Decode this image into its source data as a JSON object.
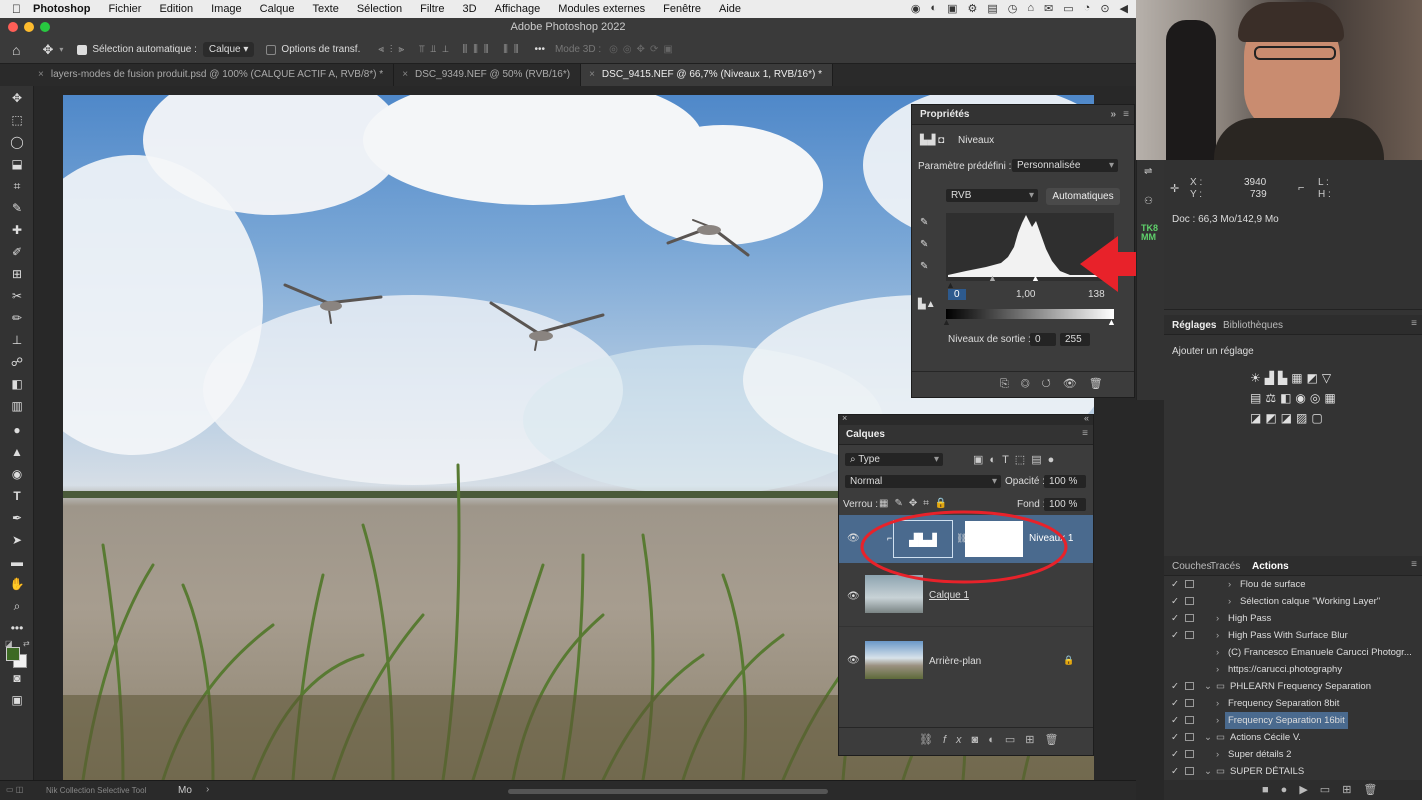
{
  "menubar": {
    "app_name": "Photoshop",
    "items": [
      "Fichier",
      "Edition",
      "Image",
      "Calque",
      "Texte",
      "Sélection",
      "Filtre",
      "3D",
      "Affichage",
      "Modules externes",
      "Fenêtre",
      "Aide"
    ]
  },
  "window_title": "Adobe Photoshop 2022",
  "options_bar": {
    "auto_select_label": "Sélection automatique :",
    "auto_select_value": "Calque",
    "transform_options_label": "Options de transf.",
    "mode_3d_label": "Mode 3D :"
  },
  "tabs": [
    {
      "label": "layers-modes de fusion produit.psd @ 100% (CALQUE ACTIF A, RVB/8*) *",
      "active": false
    },
    {
      "label": "DSC_9349.NEF @ 50% (RVB/16*)",
      "active": false
    },
    {
      "label": "DSC_9415.NEF @ 66,7% (Niveaux 1, RVB/16*) *",
      "active": true
    }
  ],
  "properties": {
    "title": "Propriétés",
    "adjustment_name": "Niveaux",
    "preset_label": "Paramètre prédéfini :",
    "preset_value": "Personnalisée",
    "channel_value": "RVB",
    "auto_button": "Automatiques",
    "input_black": "0",
    "input_gamma": "1,00",
    "input_white": "138",
    "output_label": "Niveaux de sortie :",
    "output_black": "0",
    "output_white": "255"
  },
  "layers_panel": {
    "title": "Calques",
    "filter_kind": "Type",
    "blend_mode": "Normal",
    "opacity_label": "Opacité :",
    "opacity_value": "100 %",
    "lock_label": "Verrou :",
    "fill_label": "Fond :",
    "fill_value": "100 %",
    "layers": [
      {
        "name": "Niveaux 1",
        "selected": true
      },
      {
        "name": "Calque 1",
        "selected": false
      },
      {
        "name": "Arrière-plan",
        "selected": false
      }
    ]
  },
  "info_panel": {
    "x_label": "X :",
    "y_label": "Y :",
    "x_value": "3940",
    "y_value": "739",
    "l_label": "L :",
    "h_label": "H :",
    "doc_label": "Doc : 66,3 Mo/142,9 Mo"
  },
  "adjustments_panel": {
    "tabs": [
      "Réglages",
      "Bibliothèques"
    ],
    "hint": "Ajouter un réglage"
  },
  "actions_panel": {
    "tabs": [
      "Couches",
      "Tracés",
      "Actions"
    ],
    "active_tab": "Actions",
    "items": [
      {
        "label": "Flou de surface",
        "indent": 2,
        "check": true,
        "box": true,
        "folder": false,
        "highlight": false
      },
      {
        "label": "Sélection calque \"Working Layer\"",
        "indent": 2,
        "check": true,
        "box": true,
        "folder": false,
        "highlight": false
      },
      {
        "label": "High Pass",
        "indent": 1,
        "check": true,
        "box": true,
        "folder": false,
        "highlight": false
      },
      {
        "label": "High Pass With Surface Blur",
        "indent": 1,
        "check": true,
        "box": true,
        "folder": false,
        "highlight": false
      },
      {
        "label": "(C) Francesco Emanuele Carucci Photogr...",
        "indent": 1,
        "check": false,
        "box": false,
        "folder": false,
        "highlight": false
      },
      {
        "label": "https://carucci.photography",
        "indent": 1,
        "check": false,
        "box": false,
        "folder": false,
        "highlight": false
      },
      {
        "label": "PHLEARN Frequency Separation",
        "indent": 0,
        "check": true,
        "box": true,
        "folder": true,
        "highlight": false
      },
      {
        "label": "Frequency Separation 8bit",
        "indent": 1,
        "check": true,
        "box": true,
        "folder": false,
        "highlight": false
      },
      {
        "label": "Frequency Separation 16bit",
        "indent": 1,
        "check": true,
        "box": true,
        "folder": false,
        "highlight": true
      },
      {
        "label": "Actions Cécile V.",
        "indent": 0,
        "check": true,
        "box": true,
        "folder": true,
        "highlight": false
      },
      {
        "label": "Super détails 2",
        "indent": 1,
        "check": true,
        "box": true,
        "folder": false,
        "highlight": false
      },
      {
        "label": "SUPER DÉTAILS",
        "indent": 0,
        "check": true,
        "box": true,
        "folder": true,
        "highlight": false
      }
    ]
  },
  "status_bar": {
    "plugin": "Nik Collection Selective Tool",
    "size_unit": "Mo"
  },
  "colors": {
    "accent_red": "#e8222a",
    "selection_blue": "#4a6a8e"
  }
}
